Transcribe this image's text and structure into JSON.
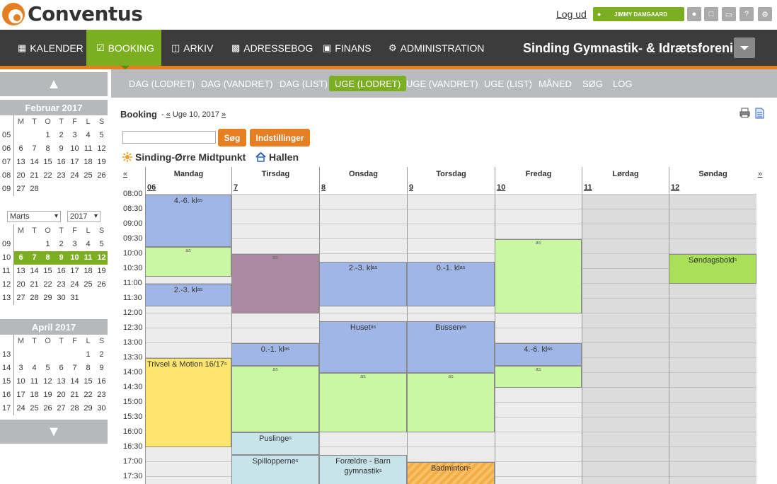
{
  "header": {
    "logo_text": "Conventus",
    "logout": "Log ud",
    "user": "JIMMY DAMGAARD",
    "icons": [
      "chat-icon",
      "bank-icon",
      "monitor-icon",
      "help-icon",
      "gear-icon"
    ]
  },
  "nav": {
    "items": [
      {
        "label": "KALENDER",
        "icon": "calendar-icon"
      },
      {
        "label": "BOOKING",
        "icon": "booking-icon",
        "active": true
      },
      {
        "label": "ARKIV",
        "icon": "folder-icon"
      },
      {
        "label": "ADRESSEBOG",
        "icon": "addressbook-icon"
      },
      {
        "label": "FINANS",
        "icon": "bank-icon"
      },
      {
        "label": "ADMINISTRATION",
        "icon": "gear-icon"
      }
    ],
    "org_name": "Sinding Gymnastik- & Idrætsforening"
  },
  "subnav": {
    "items": [
      "DAG (LODRET)",
      "DAG (VANDRET)",
      "DAG (LIST)",
      "UGE (LODRET)",
      "UGE (VANDRET)",
      "UGE (LIST)",
      "MÅNED",
      "SØG",
      "LOG"
    ],
    "active": "UGE (LODRET)"
  },
  "sidebar": {
    "dow": [
      "M",
      "T",
      "O",
      "T",
      "F",
      "L",
      "S"
    ],
    "feb": {
      "title": "Februar 2017",
      "rows": [
        {
          "wk": "05",
          "days": [
            "",
            "",
            "1",
            "2",
            "3",
            "4",
            "5"
          ]
        },
        {
          "wk": "06",
          "days": [
            "6",
            "7",
            "8",
            "9",
            "10",
            "11",
            "12"
          ]
        },
        {
          "wk": "07",
          "days": [
            "13",
            "14",
            "15",
            "16",
            "17",
            "18",
            "19"
          ]
        },
        {
          "wk": "08",
          "days": [
            "20",
            "21",
            "22",
            "23",
            "24",
            "25",
            "26"
          ]
        },
        {
          "wk": "09",
          "days": [
            "27",
            "28",
            "",
            "",
            "",
            "",
            ""
          ]
        }
      ]
    },
    "mar": {
      "month_select": "Marts",
      "year_select": "2017",
      "rows": [
        {
          "wk": "09",
          "days": [
            "",
            "",
            "1",
            "2",
            "3",
            "4",
            "5"
          ]
        },
        {
          "wk": "10",
          "days": [
            "6",
            "7",
            "8",
            "9",
            "10",
            "11",
            "12"
          ],
          "selected": true
        },
        {
          "wk": "11",
          "days": [
            "13",
            "14",
            "15",
            "16",
            "17",
            "18",
            "19"
          ]
        },
        {
          "wk": "12",
          "days": [
            "20",
            "21",
            "22",
            "23",
            "24",
            "25",
            "26"
          ]
        },
        {
          "wk": "13",
          "days": [
            "27",
            "28",
            "29",
            "30",
            "31",
            "",
            ""
          ]
        }
      ]
    },
    "apr": {
      "title": "April 2017",
      "rows": [
        {
          "wk": "13",
          "days": [
            "",
            "",
            "",
            "",
            "",
            "1",
            "2"
          ]
        },
        {
          "wk": "14",
          "days": [
            "3",
            "4",
            "5",
            "6",
            "7",
            "8",
            "9"
          ]
        },
        {
          "wk": "15",
          "days": [
            "10",
            "11",
            "12",
            "13",
            "14",
            "15",
            "16"
          ]
        },
        {
          "wk": "16",
          "days": [
            "17",
            "18",
            "19",
            "20",
            "21",
            "22",
            "23"
          ]
        },
        {
          "wk": "17",
          "days": [
            "24",
            "25",
            "26",
            "27",
            "28",
            "29",
            "30"
          ]
        }
      ]
    }
  },
  "booking": {
    "title": "Booking",
    "prev_link": "«",
    "week_label": "Uge 10, 2017",
    "next_link": "»",
    "search_value": "",
    "search_button": "Søg",
    "settings_button": "Indstillinger",
    "location1": "Sinding-Ørre Midtpunkt",
    "location2": "Hallen"
  },
  "week": {
    "prev": "«",
    "next": "»",
    "days": [
      {
        "name": "Mandag",
        "date": "06"
      },
      {
        "name": "Tirsdag",
        "date": "7"
      },
      {
        "name": "Onsdag",
        "date": "8"
      },
      {
        "name": "Torsdag",
        "date": "9"
      },
      {
        "name": "Fredag",
        "date": "10"
      },
      {
        "name": "Lørdag",
        "date": "11"
      },
      {
        "name": "Søndag",
        "date": "12"
      }
    ],
    "times": [
      "08:00",
      "08:30",
      "09:00",
      "09:30",
      "10:00",
      "10:30",
      "11:00",
      "11:30",
      "12:00",
      "12:30",
      "13:00",
      "13:30",
      "14:00",
      "14:30",
      "15:00",
      "15:30",
      "16:00",
      "16:30",
      "17:00",
      "17:30"
    ],
    "events": [
      {
        "day": 0,
        "start": "08:00",
        "end": "09:45",
        "title": "4.-6. kl",
        "sup": "as",
        "color": "blue"
      },
      {
        "day": 0,
        "start": "09:45",
        "end": "10:45",
        "title": "",
        "sup": "as",
        "color": "green"
      },
      {
        "day": 0,
        "start": "11:00",
        "end": "11:45",
        "title": "2.-3. kl",
        "sup": "as",
        "color": "blue"
      },
      {
        "day": 0,
        "start": "13:30",
        "end": "16:30",
        "title": "Trivsel & Motion 16/17",
        "sup": "s",
        "color": "yellow",
        "left": true
      },
      {
        "day": 1,
        "start": "10:00",
        "end": "12:00",
        "title": "",
        "sup": "as",
        "color": "purple"
      },
      {
        "day": 1,
        "start": "13:00",
        "end": "13:45",
        "title": "0.-1. kl",
        "sup": "as",
        "color": "blue"
      },
      {
        "day": 1,
        "start": "13:45",
        "end": "16:00",
        "title": "",
        "sup": "as",
        "color": "green"
      },
      {
        "day": 1,
        "start": "16:00",
        "end": "16:45",
        "title": "Puslinge",
        "sup": "s",
        "color": "lightblue"
      },
      {
        "day": 1,
        "start": "16:45",
        "end": "17:45",
        "title": "Spillopperne",
        "sup": "s",
        "color": "lightblue"
      },
      {
        "day": 2,
        "start": "10:15",
        "end": "11:45",
        "title": "2.-3. kl",
        "sup": "as",
        "color": "blue"
      },
      {
        "day": 2,
        "start": "12:15",
        "end": "14:00",
        "title": "Huset",
        "sup": "as",
        "color": "blue"
      },
      {
        "day": 2,
        "start": "14:00",
        "end": "16:00",
        "title": "",
        "sup": "as",
        "color": "green"
      },
      {
        "day": 2,
        "start": "16:45",
        "end": "17:45",
        "title": "Forældre - Barn gymnastik",
        "sup": "s",
        "color": "lightblue"
      },
      {
        "day": 3,
        "start": "10:15",
        "end": "11:45",
        "title": "0.-1. kl",
        "sup": "as",
        "color": "blue"
      },
      {
        "day": 3,
        "start": "12:15",
        "end": "14:00",
        "title": "Bussen",
        "sup": "as",
        "color": "blue"
      },
      {
        "day": 3,
        "start": "14:00",
        "end": "16:00",
        "title": "",
        "sup": "as",
        "color": "green"
      },
      {
        "day": 3,
        "start": "17:00",
        "end": "17:45",
        "title": "Badminton",
        "sup": "s",
        "color": "stripe"
      },
      {
        "day": 4,
        "start": "09:30",
        "end": "12:00",
        "title": "",
        "sup": "as",
        "color": "green"
      },
      {
        "day": 4,
        "start": "13:00",
        "end": "13:45",
        "title": "4.-6. kl",
        "sup": "as",
        "color": "blue"
      },
      {
        "day": 4,
        "start": "13:45",
        "end": "14:30",
        "title": "",
        "sup": "as",
        "color": "green"
      },
      {
        "day": 6,
        "start": "10:00",
        "end": "11:00",
        "title": "Søndagsbold",
        "sup": "s",
        "color": "lime"
      }
    ]
  }
}
